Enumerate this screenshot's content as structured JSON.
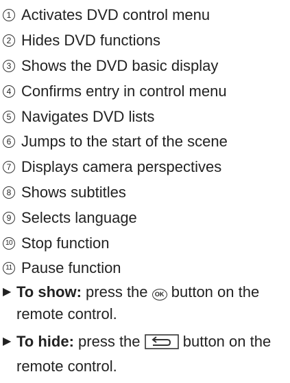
{
  "legend": {
    "items": [
      {
        "number": "1",
        "label": "Activates DVD control menu"
      },
      {
        "number": "2",
        "label": "Hides DVD functions"
      },
      {
        "number": "3",
        "label": "Shows the DVD basic display"
      },
      {
        "number": "4",
        "label": "Confirms entry in control menu"
      },
      {
        "number": "5",
        "label": "Navigates DVD lists"
      },
      {
        "number": "6",
        "label": "Jumps to the start of the scene"
      },
      {
        "number": "7",
        "label": "Displays camera perspectives"
      },
      {
        "number": "8",
        "label": "Shows subtitles"
      },
      {
        "number": "9",
        "label": "Selects language"
      },
      {
        "number": "10",
        "label": "Stop function"
      },
      {
        "number": "11",
        "label": "Pause function"
      }
    ]
  },
  "instructions": {
    "show": {
      "bullet": "▶",
      "label": "To show:",
      "before": " press the ",
      "button_text": "OK",
      "button_icon": "ok-button-icon",
      "after": " button on the remote control."
    },
    "hide": {
      "bullet": "▶",
      "label": "To hide:",
      "before": " press the ",
      "button_icon": "back-button-icon",
      "after": " button on the remote control."
    }
  }
}
